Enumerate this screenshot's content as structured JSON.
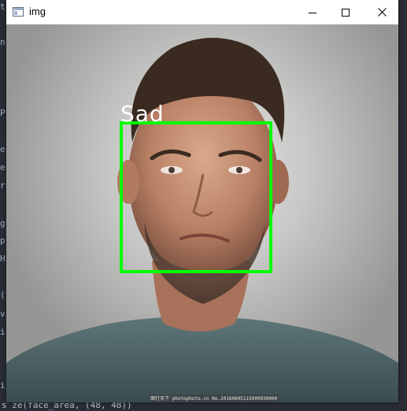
{
  "window": {
    "title": "img",
    "controls": {
      "minimize": "minimize-icon",
      "maximize": "maximize-icon",
      "close": "close-icon"
    }
  },
  "detection": {
    "label": "Sad",
    "box_color": "#00ff00",
    "label_color": "#ffffff"
  },
  "watermark": "图行天下 photophoto.cn No.20160605115000030000",
  "ide": {
    "left_chars": [
      "t",
      "n",
      "P",
      "e",
      "e",
      "r",
      "g",
      "p",
      "H",
      "(",
      "v",
      "i",
      "i"
    ],
    "bottom_line": "s ze(face_area, (48, 48))"
  }
}
